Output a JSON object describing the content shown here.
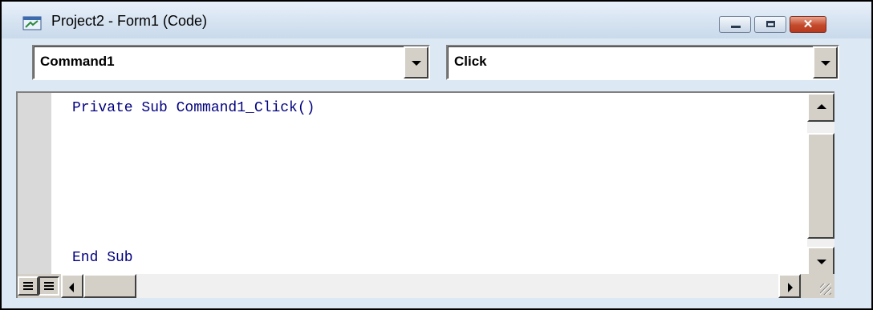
{
  "window": {
    "title": "Project2 - Form1 (Code)",
    "icon": "vb-form-icon"
  },
  "object_combo": {
    "value": "Command1"
  },
  "procedure_combo": {
    "value": "Click"
  },
  "code": {
    "lines": [
      "Private Sub Command1_Click()",
      "End Sub"
    ],
    "text_color": "#00007f"
  },
  "colors": {
    "title_gradient_top": "#e9f1fa",
    "close_button": "#c44a2c",
    "editor_margin": "#d9d9d9"
  }
}
